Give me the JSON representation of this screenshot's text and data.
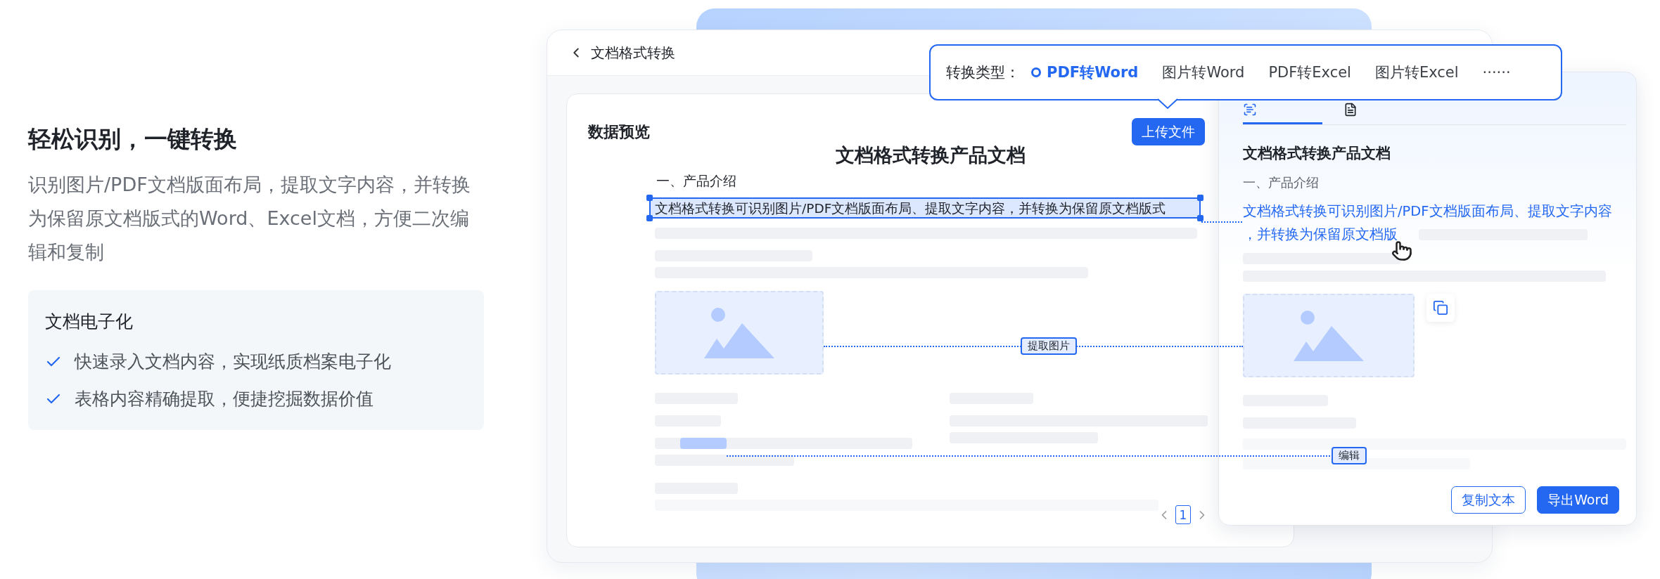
{
  "intro": {
    "title": "轻松识别，一键转换",
    "description": "识别图片/PDF文档版面布局，提取文字内容，并转换为保留原文档版式的Word、Excel文档，方便二次编辑和复制"
  },
  "feature_card": {
    "title": "文档电子化",
    "items": [
      "快速录入文档内容，实现纸质档案电子化",
      "表格内容精确提取，便捷挖掘数据价值"
    ]
  },
  "main_window": {
    "title": "文档格式转换",
    "preview_title": "数据预览",
    "upload_button": "上传文件",
    "document": {
      "title": "文档格式转换产品文档",
      "section": "一、产品介绍",
      "selected_line": "文档格式转换可识别图片/PDF文档版面布局、提取文字内容，并转换为保留原文档版式"
    },
    "extract_tag": "提取图片",
    "pages": [
      {
        "label": "1",
        "selected": true
      }
    ]
  },
  "conversion_popover": {
    "label": "转换类型：",
    "options": [
      {
        "label": "PDF转Word",
        "selected": true
      },
      {
        "label": "图片转Word",
        "selected": false
      },
      {
        "label": "PDF转Excel",
        "selected": false
      },
      {
        "label": "图片转Excel",
        "selected": false
      }
    ],
    "more": "······"
  },
  "result_panel": {
    "tabs": [
      {
        "kind": "result",
        "selected": true
      },
      {
        "kind": "json",
        "selected": false
      }
    ],
    "title": "文档格式转换产品文档",
    "section": "一、产品介绍",
    "recognized_text": "文档格式转换可识别图片/PDF文档版面布局、提取文字内容，并转换为保留原文档版",
    "edit_tag": "编辑",
    "buttons": [
      {
        "label": "复制文本",
        "kind": "outline"
      },
      {
        "label": "导出Word",
        "kind": "primary"
      }
    ]
  }
}
